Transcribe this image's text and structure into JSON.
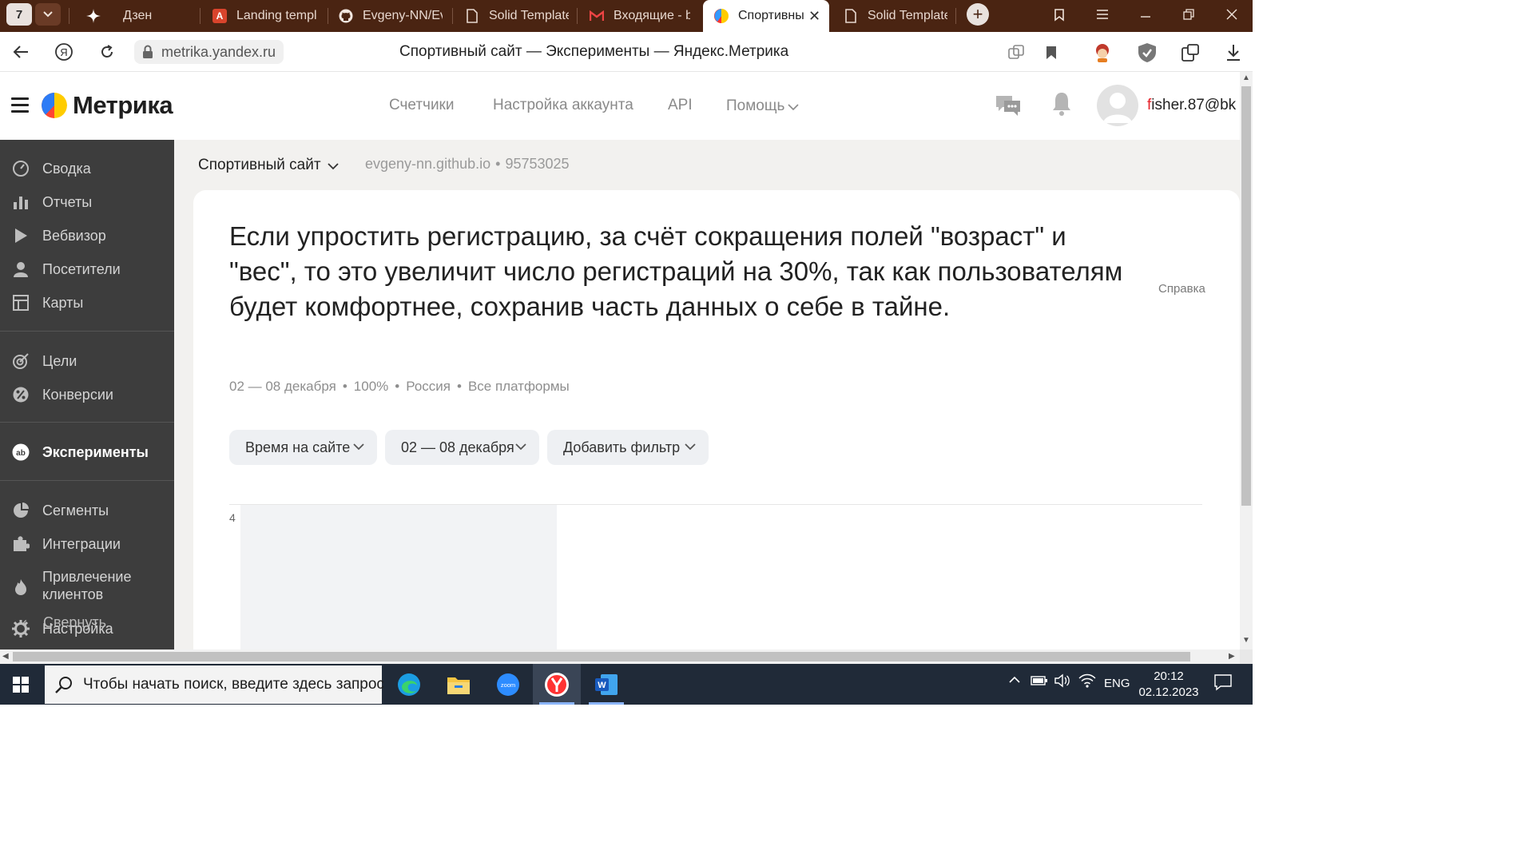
{
  "browser": {
    "tab_count": "7",
    "tabs": [
      {
        "label": "Дзен",
        "icon": "zen-icon"
      },
      {
        "label": "Landing templ",
        "icon": "translate-icon"
      },
      {
        "label": "Evgeny-NN/Ev",
        "icon": "github-icon"
      },
      {
        "label": "Solid Template",
        "icon": "page-icon"
      },
      {
        "label": "Входящие - b",
        "icon": "mail-icon"
      },
      {
        "label": "Спортивны",
        "icon": "metrika-icon",
        "active": true
      },
      {
        "label": "Solid Template",
        "icon": "page-icon"
      }
    ],
    "url": "metrika.yandex.ru",
    "page_title": "Спортивный сайт — Эксперименты — Яндекс.Метрика"
  },
  "header": {
    "brand": "Метрика",
    "nav": [
      "Счетчики",
      "Настройка аккаунта",
      "API",
      "Помощь"
    ],
    "account_first": "f",
    "account_rest": "isher.87@bk"
  },
  "sidebar": {
    "groups": [
      [
        {
          "label": "Сводка",
          "icon": "dashboard-icon"
        },
        {
          "label": "Отчеты",
          "icon": "reports-icon"
        },
        {
          "label": "Вебвизор",
          "icon": "play-icon"
        },
        {
          "label": "Посетители",
          "icon": "user-icon"
        },
        {
          "label": "Карты",
          "icon": "map-icon"
        }
      ],
      [
        {
          "label": "Цели",
          "icon": "target-icon"
        },
        {
          "label": "Конверсии",
          "icon": "percent-icon"
        }
      ],
      [
        {
          "label": "Эксперименты",
          "icon": "ab-icon",
          "active": true
        }
      ],
      [
        {
          "label": "Сегменты",
          "icon": "pie-icon"
        },
        {
          "label": "Интеграции",
          "icon": "puzzle-icon"
        },
        {
          "label": "Привлечение клиентов",
          "icon": "fire-icon"
        }
      ]
    ],
    "settings_label": "Настройка",
    "collapse_label": "Свернуть"
  },
  "counter": {
    "name": "Спортивный сайт",
    "domain": "evgeny-nn.github.io",
    "id": "95753025"
  },
  "experiment": {
    "hypothesis": "Если упростить регистрацию, за счёт сокращения полей \"возраст\" и \"вес\", то это увеличит число регистраций на 30%, так как пользователям будет комфортнее, сохранив часть данных о себе в тайне.",
    "help_label": "Справка",
    "period": "02 — 08 декабря",
    "share": "100%",
    "region": "Россия",
    "platforms": "Все платформы",
    "filters": [
      "Время на сайте",
      "02 — 08 декабря",
      "Добавить фильтр"
    ],
    "chart_y_tick": "4"
  },
  "taskbar": {
    "search_placeholder": "Чтобы начать поиск, введите здесь запрос",
    "language": "ENG",
    "time": "20:12",
    "date": "02.12.2023"
  },
  "colors": {
    "sidebar_bg": "#3d3d3d",
    "content_bg": "#f2f1ef",
    "browser_chrome": "#4a2412",
    "account_accent": "#e6222a"
  }
}
